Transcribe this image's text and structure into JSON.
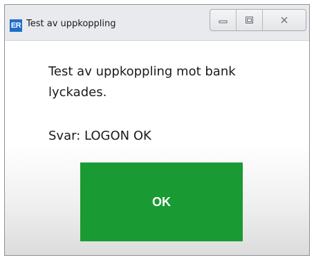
{
  "window": {
    "app_icon_text": "ER",
    "title": "Test av uppkoppling",
    "controls": {
      "minimize": "minimize",
      "maximize": "maximize",
      "close": "close"
    }
  },
  "dialog": {
    "message": "Test av uppkoppling mot bank lyckades.",
    "response": "Svar: LOGON OK",
    "ok_label": "OK"
  },
  "colors": {
    "ok_button": "#1a9a32",
    "app_icon": "#1e6ec9"
  }
}
